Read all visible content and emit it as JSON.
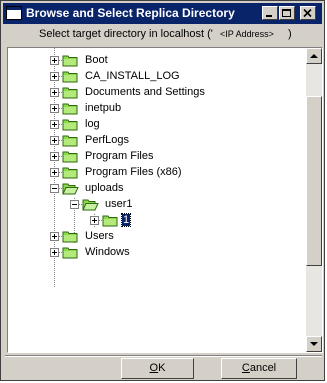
{
  "window": {
    "title": "Browse and Select Replica Directory",
    "subtitle": "Select target directory in localhost ('",
    "ip_placeholder": "<IP Address>",
    "subtitle_close": ")"
  },
  "tree": {
    "items": [
      {
        "label": "Boot",
        "expander": "plus"
      },
      {
        "label": "CA_INSTALL_LOG",
        "expander": "plus"
      },
      {
        "label": "Documents and Settings",
        "expander": "plus"
      },
      {
        "label": "inetpub",
        "expander": "plus"
      },
      {
        "label": "log",
        "expander": "plus"
      },
      {
        "label": "PerfLogs",
        "expander": "plus"
      },
      {
        "label": "Program Files",
        "expander": "plus"
      },
      {
        "label": "Program Files (x86)",
        "expander": "plus"
      },
      {
        "label": "uploads",
        "expander": "minus",
        "open": true
      },
      {
        "label": "user1",
        "expander": "minus",
        "open": true
      },
      {
        "label": "1",
        "expander": "plus",
        "selected": true
      },
      {
        "label": "Users",
        "expander": "plus"
      },
      {
        "label": "Windows",
        "expander": "plus"
      }
    ]
  },
  "buttons": {
    "ok_prefix": "",
    "ok_mnemonic": "O",
    "ok_rest": "K",
    "cancel_prefix": "",
    "cancel_mnemonic": "C",
    "cancel_rest": "ancel"
  },
  "colors": {
    "titlebar": "#0a246a",
    "folder": "#8fd64d",
    "selection": "#0a246a"
  },
  "icons": {
    "app": "window-app-icon",
    "minimize": "minimize-icon",
    "maximize": "maximize-icon",
    "close": "close-icon",
    "folder": "folder-icon",
    "open_folder": "open-folder-icon"
  }
}
